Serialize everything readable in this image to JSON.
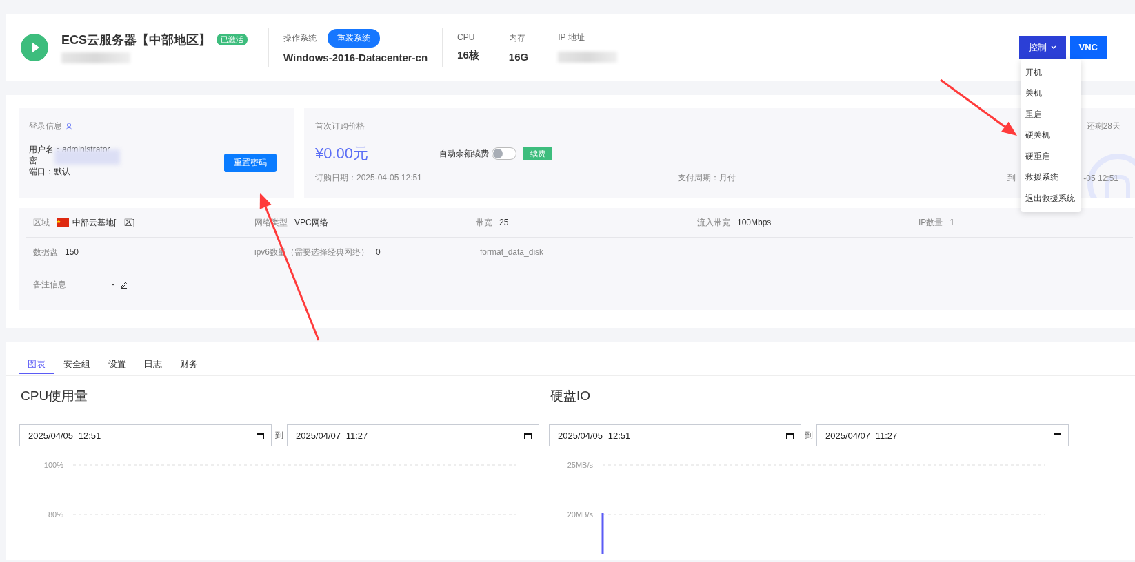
{
  "server": {
    "title": "ECS云服务器【中部地区】",
    "badge": "已激活",
    "os_label": "操作系统",
    "reinstall_button": "重装系统",
    "os_value": "Windows-2016-Datacenter-cn",
    "cpu_label": "CPU",
    "cpu_value": "16核",
    "memory_label": "内存",
    "memory_value": "16G",
    "ip_label": "IP 地址"
  },
  "actions": {
    "control_button": "控制",
    "vnc_button": "VNC",
    "menu_expanded": true,
    "menu_items": [
      "开机",
      "关机",
      "重启",
      "硬关机",
      "硬重启",
      "救援系统",
      "退出救援系统"
    ]
  },
  "login": {
    "title": "登录信息",
    "lines": [
      "用户名：administrator",
      "密",
      "端口：默认"
    ],
    "reset_button": "重置密码"
  },
  "price": {
    "title": "首次订购价格",
    "amount": "¥0.00元",
    "auto_renew_label": "自动余额续费",
    "auto_renew_on": false,
    "renew_button": "续费",
    "order_date": "订购日期：2025-04-05 12:51",
    "pay_cycle": "支付周期：月付",
    "remaining": "还剩28天",
    "expiry_start": "到",
    "expiry_end": "-05 12:51"
  },
  "specs": [
    {
      "kind": "flag",
      "label": "区域",
      "value": "中部云基地[一区]"
    },
    {
      "kind": "plain",
      "label": "网络类型",
      "value": "VPC网络"
    },
    {
      "kind": "plain",
      "label": "带宽",
      "value": "25"
    },
    {
      "kind": "plain",
      "label": "流入带宽",
      "value": "100Mbps"
    },
    {
      "kind": "plain",
      "label": "IP数量",
      "value": "1"
    },
    {
      "kind": "plain",
      "label": "数据盘",
      "value": "150"
    },
    {
      "kind": "plain",
      "label": "ipv6数量（需要选择经典网络）",
      "value": "0"
    },
    {
      "kind": "note",
      "value": "format_data_disk"
    },
    {
      "kind": "editable",
      "label": "备注信息",
      "value": "-"
    }
  ],
  "tabs": [
    {
      "label": "图表",
      "selected": true
    },
    {
      "label": "安全组",
      "selected": false
    },
    {
      "label": "设置",
      "selected": false
    },
    {
      "label": "日志",
      "selected": false
    },
    {
      "label": "财务",
      "selected": false
    }
  ],
  "charts": [
    {
      "title": "CPU使用量",
      "start": "2025/04/05 12:51",
      "separator": "到",
      "end": "2025/04/07 11:27",
      "kind": "empty",
      "axis_labels": [
        "100%",
        "80%"
      ]
    },
    {
      "title": "硬盘IO",
      "start": "2025/04/05 12:51",
      "separator": "到",
      "end": "2025/04/07 11:27",
      "kind": "spike",
      "axis_labels": [
        "25MB/s",
        "20MB/s"
      ]
    }
  ]
}
